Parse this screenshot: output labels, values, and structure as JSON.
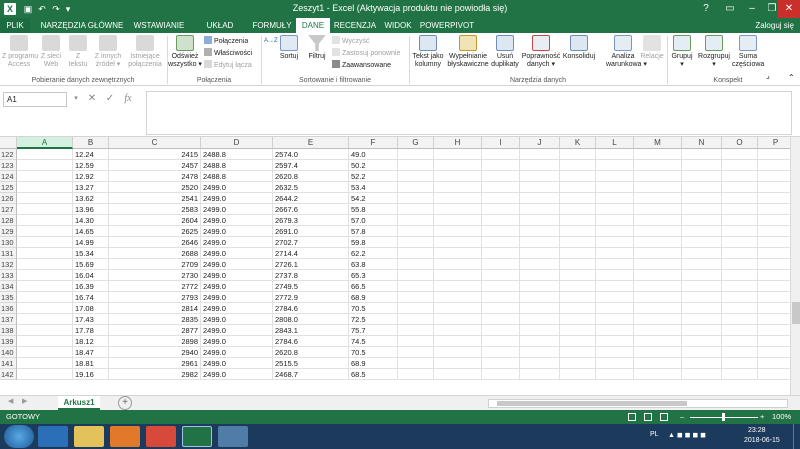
{
  "titlebar": {
    "title": "Zeszyt1 -  Excel (Aktywacja produktu nie powiodła się)",
    "help": "?",
    "minimize": "–",
    "restore": "❐",
    "close": "✕"
  },
  "tabs": [
    "PLIK",
    "NARZĘDZIA GŁÓWNE",
    "WSTAWIANIE",
    "UKŁAD STRONY",
    "FORMUŁY",
    "DANE",
    "RECENZJA",
    "WIDOK",
    "POWERPIVOT"
  ],
  "active_tab": "DANE",
  "login": "Zaloguj się",
  "ribbon": {
    "get_external": [
      {
        "label": "Z programu\nAccess"
      },
      {
        "label": "Z sieci\nWeb"
      },
      {
        "label": "Z\ntekstu"
      },
      {
        "label": "Z innych\nźródeł ▾"
      },
      {
        "label": "Istniejące\npołączenia"
      }
    ],
    "get_external_label": "Pobieranie danych zewnętrznych",
    "refresh": "Odśwież\nwszystko ▾",
    "connections_items": [
      "Połączenia",
      "Właściwości",
      "Edytuj łącza"
    ],
    "connections_label": "Połączenia",
    "sort_az": "A→Z",
    "sort": "Sortuj",
    "filter": "Filtruj",
    "filter_items": [
      "Wyczyść",
      "Zastosuj ponownie",
      "Zaawansowane"
    ],
    "sort_label": "Sortowanie i filtrowanie",
    "tools": [
      {
        "label": "Tekst jako\nkolumny"
      },
      {
        "label": "Wypełnianie\nbłyskawiczne"
      },
      {
        "label": "Usuń\nduplikaty"
      },
      {
        "label": "Poprawność\ndanych ▾"
      },
      {
        "label": "Konsoliduj"
      },
      {
        "label": "Analiza\nwarunkowa ▾"
      },
      {
        "label": "Relacje"
      }
    ],
    "tools_label": "Narzędzia danych",
    "outline": [
      {
        "label": "Grupuj\n▾"
      },
      {
        "label": "Rozgrupuj\n▾"
      },
      {
        "label": "Suma\nczęściowa"
      }
    ],
    "outline_label": "Konspekt",
    "colors": {
      "accent": "#217346",
      "disabled": "#a0a0a0"
    }
  },
  "formula": {
    "namebox": "A1",
    "cancel": "✕",
    "enter": "✓",
    "fx": "fx",
    "value": ""
  },
  "columns": [
    "A",
    "B",
    "C",
    "D",
    "E",
    "F",
    "G",
    "H",
    "I",
    "J",
    "K",
    "L",
    "M",
    "N",
    "O",
    "P"
  ],
  "rows": [
    {
      "n": "122",
      "b": "12.24",
      "c": "2415",
      "d": "2488.8",
      "e": "2574.0",
      "f": "49.0"
    },
    {
      "n": "123",
      "b": "12.59",
      "c": "2457",
      "d": "2488.8",
      "e": "2597.4",
      "f": "50.2"
    },
    {
      "n": "124",
      "b": "12.92",
      "c": "2478",
      "d": "2488.8",
      "e": "2620.8",
      "f": "52.2"
    },
    {
      "n": "125",
      "b": "13.27",
      "c": "2520",
      "d": "2499.0",
      "e": "2632.5",
      "f": "53.4"
    },
    {
      "n": "126",
      "b": "13.62",
      "c": "2541",
      "d": "2499.0",
      "e": "2644.2",
      "f": "54.2"
    },
    {
      "n": "127",
      "b": "13.96",
      "c": "2583",
      "d": "2499.0",
      "e": "2667.6",
      "f": "55.8"
    },
    {
      "n": "128",
      "b": "14.30",
      "c": "2604",
      "d": "2499.0",
      "e": "2679.3",
      "f": "57.0"
    },
    {
      "n": "129",
      "b": "14.65",
      "c": "2625",
      "d": "2499.0",
      "e": "2691.0",
      "f": "57.8"
    },
    {
      "n": "130",
      "b": "14.99",
      "c": "2646",
      "d": "2499.0",
      "e": "2702.7",
      "f": "59.8"
    },
    {
      "n": "131",
      "b": "15.34",
      "c": "2688",
      "d": "2499.0",
      "e": "2714.4",
      "f": "62.2"
    },
    {
      "n": "132",
      "b": "15.69",
      "c": "2709",
      "d": "2499.0",
      "e": "2726.1",
      "f": "63.8"
    },
    {
      "n": "133",
      "b": "16.04",
      "c": "2730",
      "d": "2499.0",
      "e": "2737.8",
      "f": "65.3"
    },
    {
      "n": "134",
      "b": "16.39",
      "c": "2772",
      "d": "2499.0",
      "e": "2749.5",
      "f": "66.5"
    },
    {
      "n": "135",
      "b": "16.74",
      "c": "2793",
      "d": "2499.0",
      "e": "2772.9",
      "f": "68.9"
    },
    {
      "n": "136",
      "b": "17.08",
      "c": "2814",
      "d": "2499.0",
      "e": "2784.6",
      "f": "70.5"
    },
    {
      "n": "137",
      "b": "17.43",
      "c": "2835",
      "d": "2499.0",
      "e": "2808.0",
      "f": "72.5"
    },
    {
      "n": "138",
      "b": "17.78",
      "c": "2877",
      "d": "2499.0",
      "e": "2843.1",
      "f": "75.7"
    },
    {
      "n": "139",
      "b": "18.12",
      "c": "2898",
      "d": "2499.0",
      "e": "2784.6",
      "f": "74.5"
    },
    {
      "n": "140",
      "b": "18.47",
      "c": "2940",
      "d": "2499.0",
      "e": "2620.8",
      "f": "70.5"
    },
    {
      "n": "141",
      "b": "18.81",
      "c": "2961",
      "d": "2499.0",
      "e": "2515.5",
      "f": "68.9"
    },
    {
      "n": "142",
      "b": "19.16",
      "c": "2982",
      "d": "2499.0",
      "e": "2468.7",
      "f": "68.5"
    }
  ],
  "sheet": {
    "tab": "Arkusz1",
    "add": "+",
    "prev": "◀",
    "next": "▶"
  },
  "status": {
    "text": "GOTOWY",
    "zoom": "100%",
    "minus": "–",
    "plus": "+"
  },
  "taskbar": {
    "lang": "PL",
    "time": "23:28",
    "date": "2018-06-15"
  }
}
